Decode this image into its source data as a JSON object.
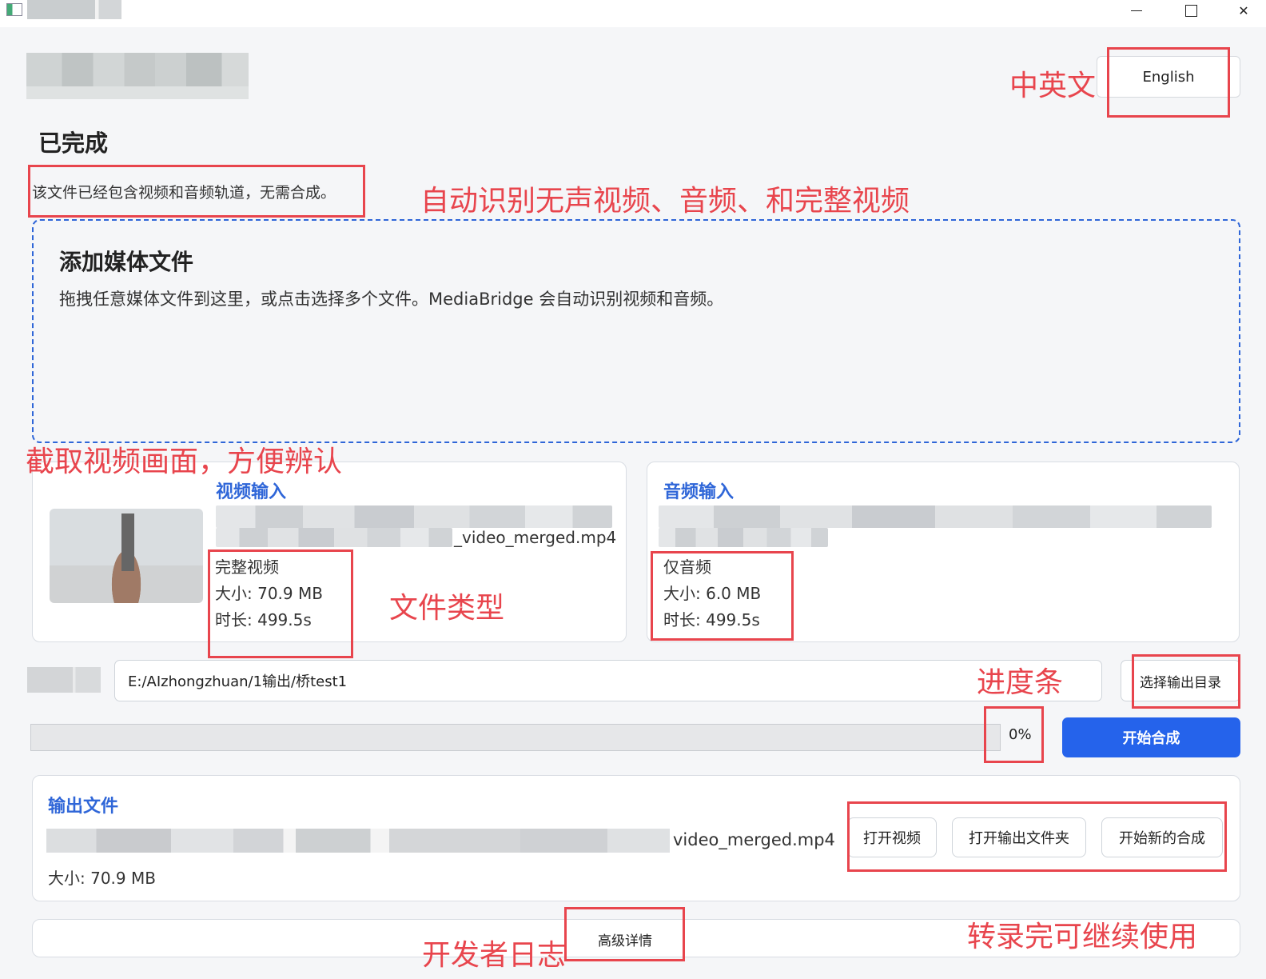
{
  "window": {
    "minimize_glyph": "",
    "maximize_glyph": "",
    "close_glyph": "✕"
  },
  "language": {
    "button_label": "English"
  },
  "status": {
    "title": "已完成",
    "message": "该文件已经包含视频和音频轨道，无需合成。"
  },
  "dropzone": {
    "title": "添加媒体文件",
    "description": "拖拽任意媒体文件到这里，或点击选择多个文件。MediaBridge 会自动识别视频和音频。"
  },
  "video_input": {
    "title": "视频输入",
    "filename_tail": "_video_merged.mp4",
    "type": "完整视频",
    "size": "大小: 70.9 MB",
    "duration": "时长: 499.5s"
  },
  "audio_input": {
    "title": "音频输入",
    "type": "仅音频",
    "size": "大小: 6.0 MB",
    "duration": "时长: 499.5s"
  },
  "output_dir": {
    "value": "E:/AIzhongzhuan/1输出/桥test1",
    "choose_label": "选择输出目录"
  },
  "progress": {
    "percent": 0,
    "text": "0%"
  },
  "start_button": "开始合成",
  "output": {
    "title": "输出文件",
    "filename_tail": "video_merged.mp4",
    "size": "大小: 70.9 MB",
    "actions": {
      "open_video": "打开视频",
      "open_folder": "打开输出文件夹",
      "new_merge": "开始新的合成"
    }
  },
  "advanced": {
    "label": "高级详情"
  },
  "annotations": {
    "language": "中英文",
    "auto_detect": "自动识别无声视频、音频、和完整视频",
    "capture": "截取视频画面，方便辨认",
    "file_type": "文件类型",
    "progress": "进度条",
    "dev_log": "开发者日志",
    "reuse": "转录完可继续使用"
  },
  "colors": {
    "accent": "#2563eb",
    "annotation": "#e8454d",
    "background": "#f5f6f8"
  }
}
